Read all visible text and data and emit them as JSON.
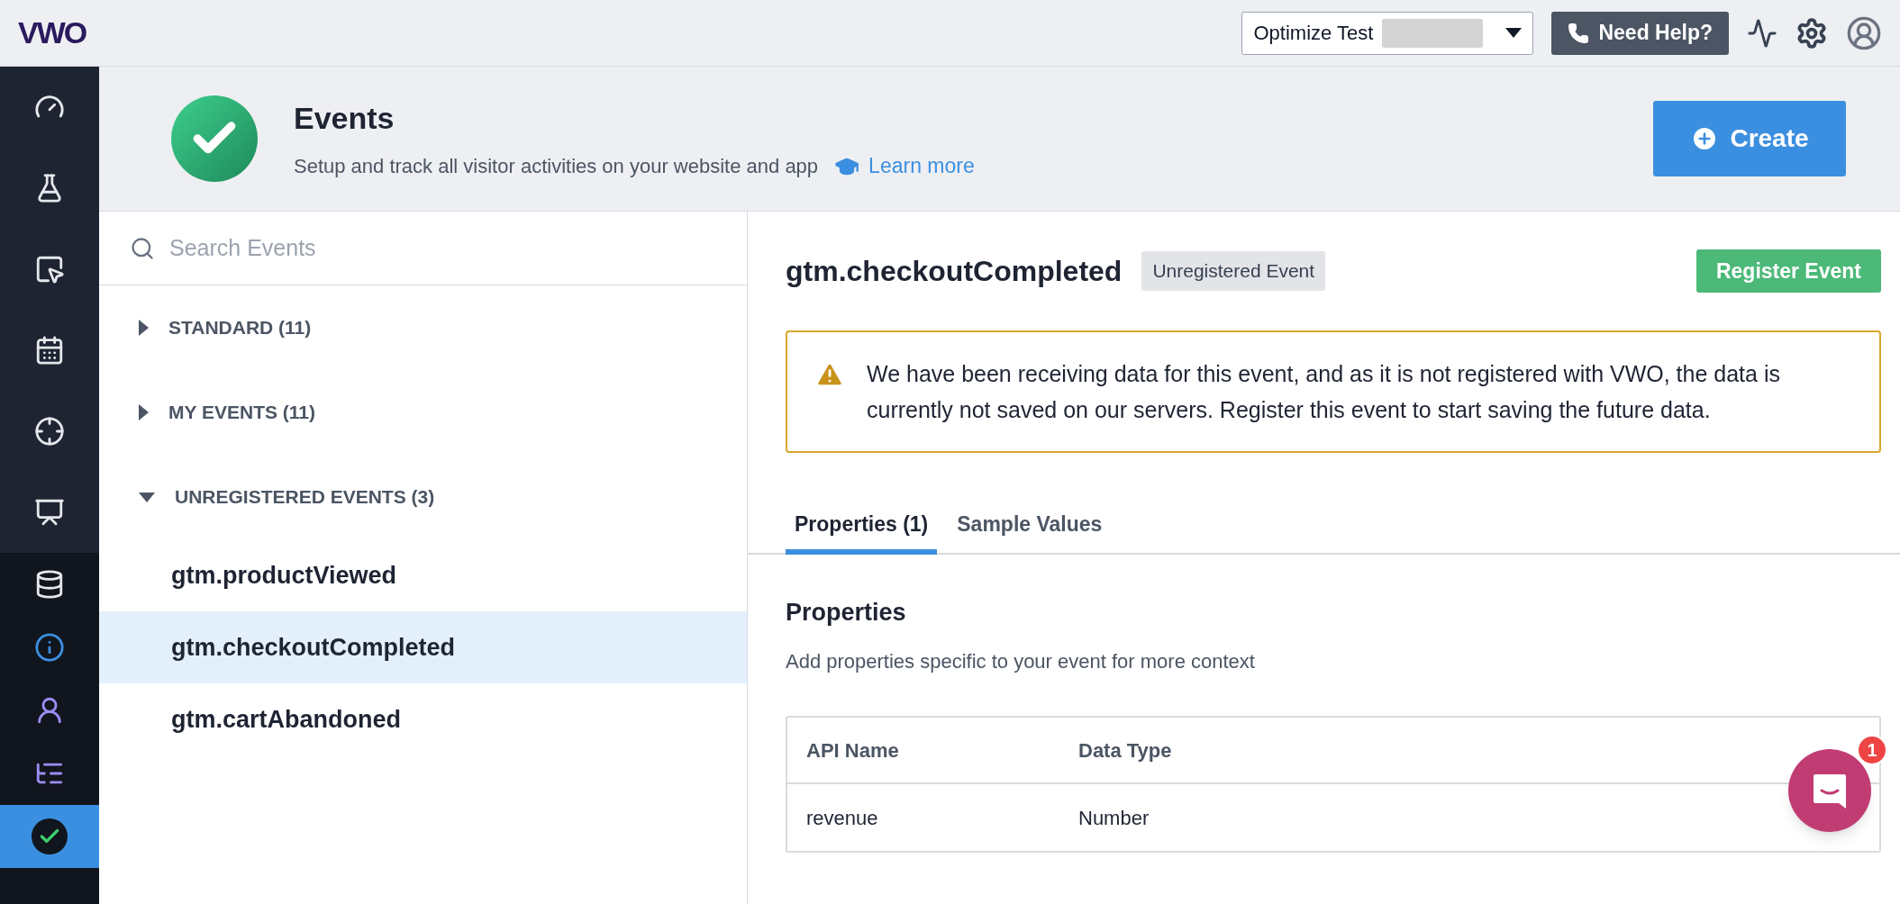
{
  "topbar": {
    "logo": "VWO",
    "account": {
      "label": "Optimize Test",
      "redacted": true
    },
    "help_button": "Need Help?"
  },
  "sidebar": {
    "top_items": [
      {
        "kind": "gauge",
        "selected": false
      },
      {
        "kind": "flask",
        "selected": false
      },
      {
        "kind": "cursor",
        "selected": false
      },
      {
        "kind": "calendar",
        "selected": false
      },
      {
        "kind": "target",
        "selected": false
      },
      {
        "kind": "present",
        "selected": false
      }
    ],
    "bottom_items": [
      {
        "kind": "database",
        "selected": false
      },
      {
        "kind": "info",
        "selected": false
      },
      {
        "kind": "user",
        "selected": false
      },
      {
        "kind": "list",
        "selected": false
      },
      {
        "kind": "check",
        "selected": true
      }
    ]
  },
  "header": {
    "title": "Events",
    "subtitle": "Setup and track all visitor activities on your website and app",
    "learn_more": "Learn more",
    "create_button": "Create"
  },
  "search": {
    "placeholder": "Search Events"
  },
  "tree": [
    {
      "label": "STANDARD (11)",
      "expanded": false
    },
    {
      "label": "MY EVENTS (11)",
      "expanded": false
    },
    {
      "label": "UNREGISTERED EVENTS (3)",
      "expanded": true,
      "children": [
        {
          "label": "gtm.productViewed",
          "selected": false
        },
        {
          "label": "gtm.checkoutCompleted",
          "selected": true
        },
        {
          "label": "gtm.cartAbandoned",
          "selected": false
        }
      ]
    }
  ],
  "detail": {
    "title": "gtm.checkoutCompleted",
    "badge": "Unregistered Event",
    "register_button": "Register Event",
    "warning": "We have been receiving data for this event, and as it is not registered with VWO, the data is currently not saved on our servers. Register this event to start saving the future data.",
    "tabs": [
      {
        "label": "Properties (1)",
        "selected": true
      },
      {
        "label": "Sample Values",
        "selected": false
      }
    ],
    "properties": {
      "heading": "Properties",
      "description": "Add properties specific to your event for more context",
      "table": {
        "columns": [
          "API Name",
          "Data Type"
        ],
        "rows": [
          [
            "revenue",
            "Number"
          ]
        ]
      }
    }
  },
  "chat": {
    "badge": "1"
  }
}
